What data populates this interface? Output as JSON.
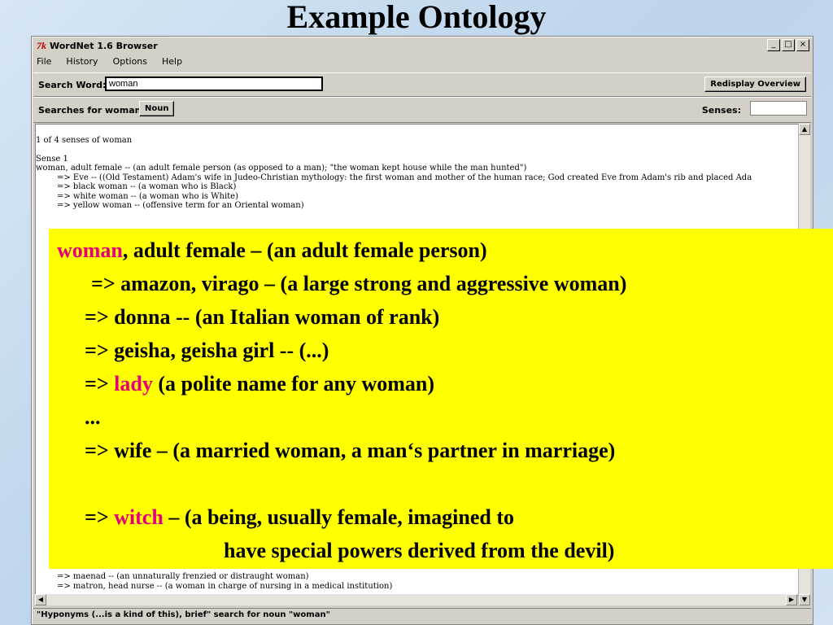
{
  "slide": {
    "title": "Example Ontology"
  },
  "window": {
    "title": "WordNet 1.6 Browser",
    "logo": "7k",
    "controls": [
      "_",
      "□",
      "×"
    ]
  },
  "menu": [
    "File",
    "History",
    "Options",
    "Help"
  ],
  "search": {
    "label": "Search Word:",
    "value": "woman",
    "redisplay_button": "Redisplay Overview"
  },
  "searches": {
    "label": "Searches for woman:",
    "noun_button": "Noun",
    "senses_label": "Senses:"
  },
  "results": {
    "header": "1 of 4 senses of woman",
    "sense_label": "Sense 1",
    "sense_gloss": "woman, adult female -- (an adult female person (as opposed to a man); \"the woman kept house while the man hunted\")",
    "hyponyms_top": [
      "=> Eve -- ((Old Testament) Adam's wife in Judeo-Christian mythology: the first woman and mother of the human race; God created Eve from Adam's rib and placed Ada",
      "=> black woman -- (a woman who is Black)",
      "=> white woman -- (a woman who is White)",
      "=> yellow woman -- (offensive term for an Oriental woman)"
    ],
    "hyponyms_bottom": [
      "=> maenad -- (an unnaturally frenzied or distraught woman)",
      "=> matron, head nurse -- (a woman in charge of nursing in a medical institution)"
    ]
  },
  "status": "\"Hyponyms (...is a kind of this), brief\" search for noun \"woman\"",
  "overlay": {
    "line1_word": "woman",
    "line1_rest": ", adult female – (an adult female person)",
    "line2": "=> amazon, virago – (a large strong and aggressive woman)",
    "line3": "=> donna -- (an Italian woman of rank)",
    "line4": "=> geisha, geisha girl -- (...)",
    "line5_prefix": "=> ",
    "line5_word": "lady",
    "line5_rest": " (a polite name for any woman)",
    "line6": "...",
    "line7": "=> wife – (a married woman, a man‘s partner in marriage)",
    "line8_prefix": "=> ",
    "line8_word": "witch",
    "line8_rest": " – (a being, usually female, imagined to",
    "line9": "have special powers derived from the devil)"
  },
  "colors": {
    "highlight": "#e4007c",
    "overlay_bg": "#ffff00",
    "slide_bg": "#c9dcef"
  }
}
